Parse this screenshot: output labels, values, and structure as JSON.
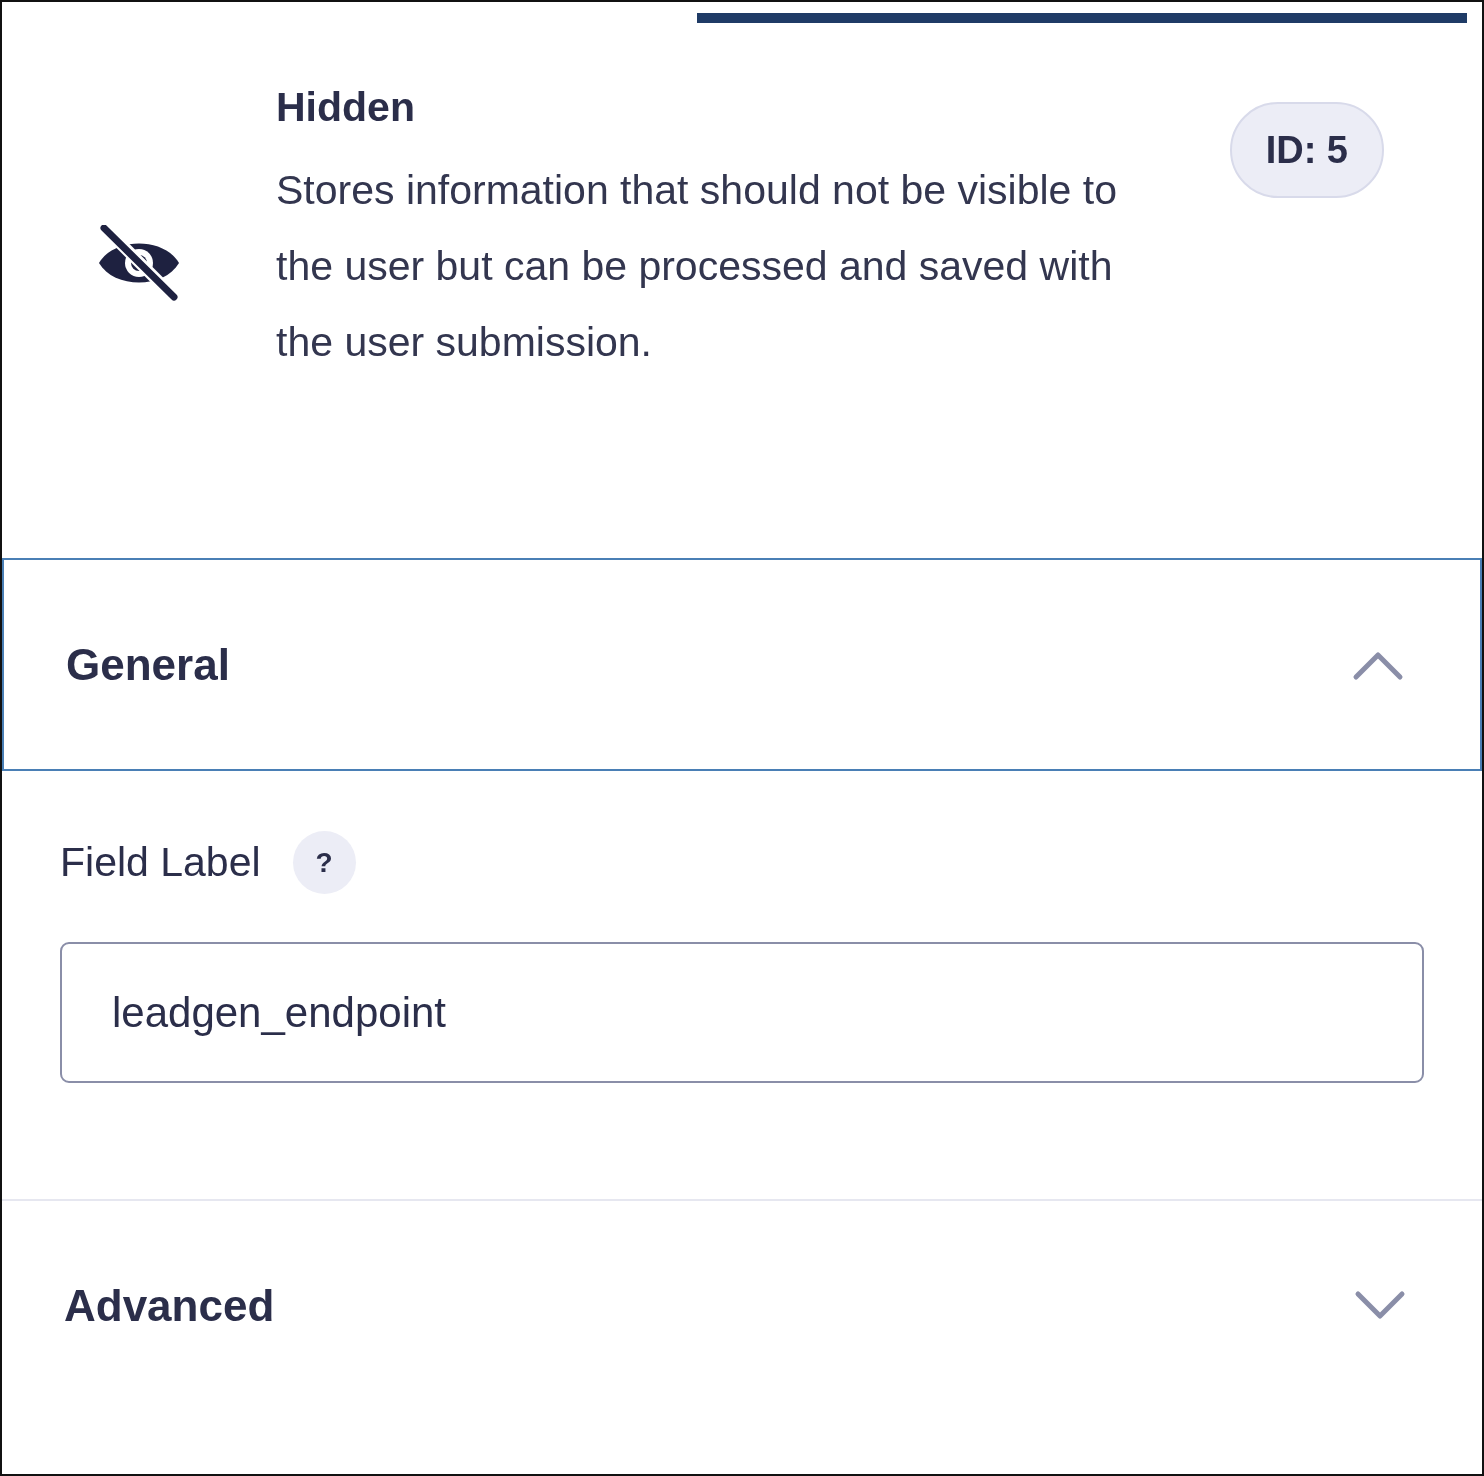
{
  "header": {
    "title": "Hidden",
    "description": "Stores information that should not be visible to the user but can be processed and saved with the user submission.",
    "badge": "ID: 5"
  },
  "sections": [
    {
      "title": "General",
      "expanded": true,
      "focused": true,
      "fields": [
        {
          "label": "Field Label",
          "help": "?",
          "value": "leadgen_endpoint"
        }
      ]
    },
    {
      "title": "Advanced",
      "expanded": false,
      "focused": false
    }
  ]
}
